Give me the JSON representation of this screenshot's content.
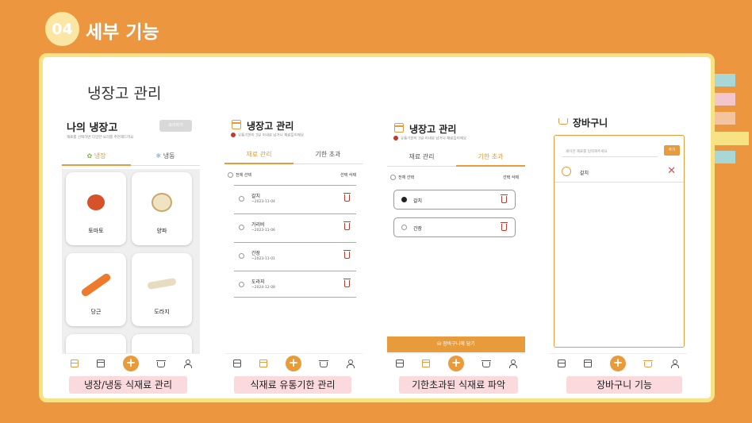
{
  "header": {
    "badge": "04",
    "title": "세부 기능"
  },
  "panel": {
    "title": "냉장고 관리"
  },
  "colors": {
    "background": "#ec963f",
    "accent": "#e89b3a",
    "panel_border": "#f7e383",
    "caption_bg": "#fadadd"
  },
  "screen1": {
    "title": "나의 냉장고",
    "subtitle": "재료를 선택하면 다양한 요리를 추천해드려요",
    "recommend_button": "요리하기",
    "tabs": [
      {
        "label": "냉장",
        "icon": "leaf-icon"
      },
      {
        "label": "냉동",
        "icon": "snowflake-icon"
      }
    ],
    "items": [
      "토마토",
      "양파",
      "당근",
      "도라지"
    ],
    "caption": "냉장/냉동 식재료 관리"
  },
  "screen2": {
    "title": "냉장고 관리",
    "notice": "유통기한이 3일 이내로 남거나 재료들이에요",
    "tabs": [
      "재료 관리",
      "기한 초과"
    ],
    "select_all": "전체 선택",
    "delete_selected": "선택 삭제",
    "items": [
      {
        "name": "갈치",
        "date": "~2023-11-04"
      },
      {
        "name": "가리비",
        "date": "~2023-11-06"
      },
      {
        "name": "간장",
        "date": "~2023-11-01"
      },
      {
        "name": "도라지",
        "date": "~2024-12-08"
      }
    ],
    "caption": "식재료 유통기한 관리"
  },
  "screen3": {
    "title": "냉장고 관리",
    "notice": "유통기한이 3일 이내로 남거나 재료들이에요",
    "tabs": [
      "재료 관리",
      "기한 초과"
    ],
    "select_all": "전체 선택",
    "delete_selected": "선택 삭제",
    "items": [
      "갈치",
      "간장"
    ],
    "cart_button": "장바구니에 담기",
    "caption": "기한초과된 식재료 파악"
  },
  "screen4": {
    "title": "장바구니",
    "input_placeholder": "새이한 재료를 입력해주세요",
    "add_button": "추가",
    "items": [
      "갈치"
    ],
    "caption": "장바구니 기능"
  },
  "nav": {
    "plus": "+"
  }
}
